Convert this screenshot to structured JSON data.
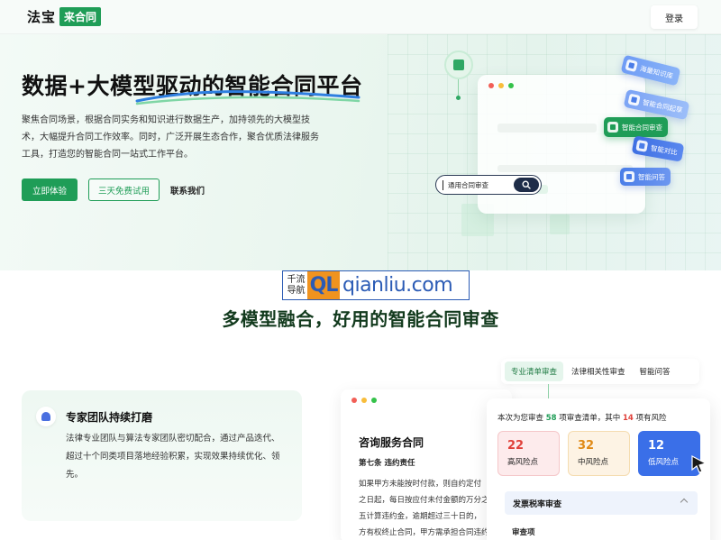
{
  "header": {
    "logo_text": "法宝",
    "logo_badge": "来合同",
    "login_label": "登录"
  },
  "hero": {
    "title": "数据+大模型驱动的智能合同平台",
    "description": "聚焦合同场景，根据合同实务和知识进行数据生产，加持领先的大模型技术，大幅提升合同工作效率。同时，广泛开展生态合作，聚合优质法律服务工具，打造您的智能合同一站式工作平台。",
    "primary_button": "立即体验",
    "secondary_button": "三天免费试用",
    "contact_link": "联系我们",
    "search_text": "通用合同审查",
    "feature_tags": [
      "海量知识库",
      "智能合同起草",
      "智能合同审查",
      "智能对比",
      "智能问答"
    ]
  },
  "watermark": {
    "cn_line1": "千流",
    "cn_line2": "导航",
    "badge": "QL",
    "url": "qianliu.com"
  },
  "section": {
    "title": "多模型融合，好用的智能合同审查",
    "tabs": [
      "专业清单审查",
      "法律相关性审查",
      "智能问答"
    ],
    "expert": {
      "title": "专家团队持续打磨",
      "description": "法律专业团队与算法专家团队密切配合，通过产品迭代、超过十个同类项目落地经验积累，实现效果持续优化、领先。"
    },
    "document": {
      "title": "咨询服务合同",
      "clause": "第七条 违约责任",
      "lines": [
        "如果甲方未能按时付款，则自约定付",
        "之日起，每日按应付未付金额的万分之",
        "五计算违约金，逾期超过三十日的，",
        "方有权终止合同，甲方需承担合同违约"
      ]
    },
    "review": {
      "summary_prefix": "本次为您审查",
      "summary_count": "58",
      "summary_middle": "项审查清单，其中",
      "summary_risk": "14",
      "summary_suffix": "项有风险",
      "risks": [
        {
          "count": "22",
          "label": "高风险点"
        },
        {
          "count": "32",
          "label": "中风险点"
        },
        {
          "count": "12",
          "label": "低风险点"
        }
      ],
      "accordion_label": "发票税率审查",
      "item_label": "审查项"
    }
  },
  "colors": {
    "brand_green": "#1f9d57",
    "risk_high": "#e0413a",
    "risk_mid": "#e08a16",
    "risk_low": "#3a6fe8"
  }
}
